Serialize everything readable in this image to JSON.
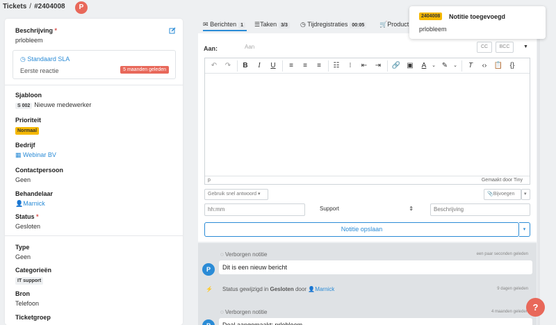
{
  "breadcrumb": {
    "root": "Tickets",
    "separator": "/",
    "ticket_number": "#2404008",
    "avatar_initial": "P"
  },
  "left": {
    "description": {
      "label": "Beschrijving",
      "required": "*",
      "value": "prlobleem"
    },
    "sla": {
      "title": "Standaard SLA",
      "row_label": "Eerste reactie",
      "badge": "5 maanden geleden"
    },
    "template": {
      "label": "Sjabloon",
      "code": "S 002",
      "value": "Nieuwe medewerker"
    },
    "priority": {
      "label": "Prioriteit",
      "value": "Normaal"
    },
    "company": {
      "label": "Bedrijf",
      "value": "Webinar BV"
    },
    "contact": {
      "label": "Contactpersoon",
      "value": "Geen"
    },
    "assignee": {
      "label": "Behandelaar",
      "value": "Marnick"
    },
    "status": {
      "label": "Status",
      "required": "*",
      "value": "Gesloten"
    },
    "type": {
      "label": "Type",
      "value": "Geen"
    },
    "categories": {
      "label": "Categorieën",
      "value": "IT support"
    },
    "source": {
      "label": "Bron",
      "value": "Telefoon"
    },
    "ticketgroup": {
      "label": "Ticketgroep"
    }
  },
  "tabs": [
    {
      "label": "Berichten",
      "count": "1",
      "icon": "envelope-icon"
    },
    {
      "label": "Taken",
      "count": "3/3",
      "icon": "tasks-icon"
    },
    {
      "label": "Tijdregistraties",
      "count": "00:05",
      "icon": "clock-icon"
    },
    {
      "label": "Product",
      "icon": "cart-icon"
    }
  ],
  "compose": {
    "to_label": "Aan:",
    "to_placeholder": "Aan",
    "cc": "CC",
    "bcc": "BCC",
    "status_path": "p",
    "made_by": "Gemaakt door Tiny",
    "quick_reply": "Gebruik snel antwoord",
    "attach": "Bijvoegen",
    "time_placeholder": "hh:mm",
    "department": "Support",
    "desc_placeholder": "Beschrijving",
    "save": "Notitie opslaan"
  },
  "feed": [
    {
      "header": "Verborgen notitie",
      "time": "een paar seconden geleden",
      "avatar": "P",
      "body": "Dit is een nieuw bericht"
    },
    {
      "status_prefix": "Status gewijzigd in",
      "status_value": "Gesloten",
      "status_by": "door",
      "status_user": "Marnick",
      "time": "9 dagen geleden"
    },
    {
      "header": "Verborgen notitie",
      "time": "4 maanden geleden",
      "avatar": "P",
      "body": "Deal aangemaakt: prlobleem"
    }
  ],
  "toast": {
    "badge": "2404008",
    "title": "Notitie toegevoegd",
    "body": "prlobleem"
  },
  "help": "?",
  "colors": {
    "accent": "#2a8bd6",
    "danger": "#e8685a",
    "warning": "#f5b800"
  }
}
